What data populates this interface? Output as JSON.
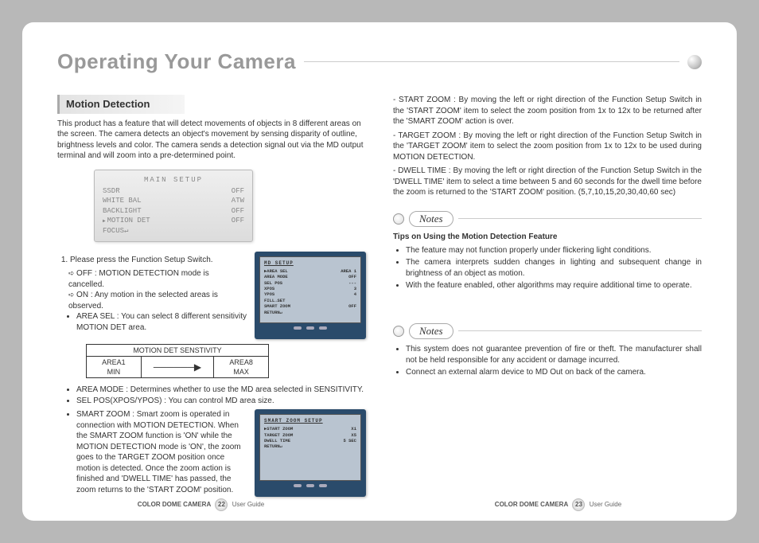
{
  "title": "Operating Your Camera",
  "section_heading": "Motion Detection",
  "intro": "This product has a feature that will detect movements of objects in 8 different areas on the screen. The camera detects an object's movement by sensing disparity of outline, brightness levels and color. The camera sends a detection signal out via the MD output terminal and will zoom into a pre-determined point.",
  "mainsetup": {
    "title": "MAIN SETUP",
    "rows": [
      {
        "k": "SSDR",
        "v": "OFF"
      },
      {
        "k": "WHITE BAL",
        "v": "ATW"
      },
      {
        "k": "BACKLIGHT",
        "v": "OFF"
      },
      {
        "k": "MOTION DET",
        "v": "OFF",
        "sel": true
      },
      {
        "k": "FOCUS↵",
        "v": ""
      }
    ]
  },
  "step1": "Please press the Function Setup Switch.",
  "step1_off": "OFF : MOTION DETECTION mode is cancelled.",
  "step1_on": "ON : Any motion in the selected areas is observed.",
  "area_sel": "AREA SEL : You can select 8 different sensitivity MOTION DET area.",
  "sens_table": {
    "title": "MOTION DET SENSTIVITY",
    "c1a": "AREA1",
    "c1b": "MIN",
    "c2a": "AREA8",
    "c2b": "MAX"
  },
  "area_mode": "AREA MODE : Determines whether to use the MD area selected in SENSITIVITY.",
  "sel_pos": "SEL POS(XPOS/YPOS) : You can control MD area size.",
  "smart_zoom_label": "SMART ZOOM :",
  "smart_zoom": "Smart zoom is operated in connection with MOTION DETECTION. When the SMART ZOOM function is 'ON' while the MOTION DETECTION mode is 'ON', the zoom goes to the TARGET ZOOM position once motion is detected. Once the zoom action is finished and 'DWELL TIME' has passed, the zoom returns to the 'START ZOOM' position.",
  "md_setup": {
    "title": "MD SETUP",
    "rows": [
      {
        "k": "▶AREA SEL",
        "v": "AREA 1"
      },
      {
        "k": " AREA MODE",
        "v": "OFF"
      },
      {
        "k": " SEL POS",
        "v": "---"
      },
      {
        "k": " XPOS",
        "v": "3"
      },
      {
        "k": " YPOS",
        "v": "4"
      },
      {
        "k": " FILL→SET",
        "v": ""
      },
      {
        "k": " SMART ZOOM",
        "v": "OFF"
      },
      {
        "k": " RETURN↵",
        "v": ""
      }
    ]
  },
  "sz_setup": {
    "title": "SMART ZOOM SETUP",
    "rows": [
      {
        "k": "▶START ZOOM",
        "v": "X1"
      },
      {
        "k": " TARGET ZOOM",
        "v": "X5"
      },
      {
        "k": " DWELL TIME",
        "v": "5 SEC"
      },
      {
        "k": " RETURN↵",
        "v": ""
      }
    ]
  },
  "start_zoom_label": "- START ZOOM :",
  "start_zoom": "By moving the left or right direction of the Function Setup Switch in the 'START ZOOM' item to select the zoom position from 1x to 12x to be returned after the 'SMART ZOOM' action is over.",
  "target_zoom_label": "- TARGET ZOOM :",
  "target_zoom": "By moving the left or right direction of the Function Setup Switch in the 'TARGET ZOOM' item to select the zoom position from 1x to 12x to be used during MOTION DETECTION.",
  "dwell_label": "- DWELL TIME :",
  "dwell": "By moving the left or right direction of the Function Setup Switch in the 'DWELL TIME' item to select a time between 5 and 60 seconds for the dwell time before the zoom is returned to the 'START ZOOM' position. (5,7,10,15,20,30,40,60 sec)",
  "notes_label": "Notes",
  "tips_title": "Tips on Using the Motion Detection Feature",
  "tips": [
    "The feature may not function properly under flickering light conditions.",
    "The camera interprets sudden changes in lighting and subsequent change in brightness of an object as motion.",
    "With the feature enabled, other algorithms may require additional time to operate."
  ],
  "notes2": [
    "This system does not guarantee prevention of fire or theft. The manufacturer shall not be held responsible for any accident or damage incurred.",
    "Connect an external alarm device to MD Out on back of the camera."
  ],
  "footer": {
    "product": "COLOR DOME CAMERA",
    "guide": "User Guide",
    "p1": "22",
    "p2": "23"
  }
}
